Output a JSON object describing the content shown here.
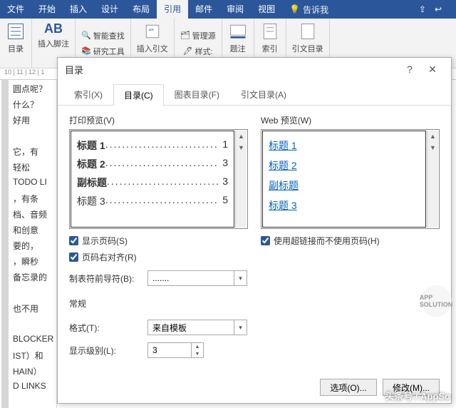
{
  "ribbon": {
    "tabs": [
      "文件",
      "开始",
      "插入",
      "设计",
      "布局",
      "引用",
      "邮件",
      "审阅",
      "视图"
    ],
    "active": "引用",
    "tell_me": "告诉我",
    "groups": {
      "toc": "目录",
      "footnote": {
        "ab": "AB",
        "label": "插入脚注",
        "sup": "1"
      },
      "research": {
        "smart": "智能查找",
        "tool": "研究工具"
      },
      "citation": "插入引文",
      "style": {
        "label": "样式:",
        "manage": "管理源"
      },
      "caption": "题注",
      "index": "索引",
      "cite_toc": "引文目录"
    }
  },
  "ruler": "10 | 11 | 12 | 1",
  "doc_lines": [
    "圆点呢？",
    "什么？",
    "好用",
    "",
    "它，有",
    "轻松",
    "TODO LI",
    "，有条",
    "档、音频",
    "和创意",
    "要的，",
    "，瞬秒",
    "备忘录的",
    "",
    "也不用",
    "",
    "BLOCKER",
    "IST）和",
    "HAIN）",
    "D LINKS"
  ],
  "dialog": {
    "title": "目录",
    "tabs": {
      "index": "索引(X)",
      "toc": "目录(C)",
      "fig": "图表目录(F)",
      "auth": "引文目录(A)"
    },
    "print_preview_label": "打印预览(V)",
    "web_preview_label": "Web 预览(W)",
    "print_items": [
      {
        "title": "标题  1",
        "page": "1",
        "bold": true
      },
      {
        "title": "标题  2",
        "page": "3",
        "bold": true
      },
      {
        "title": "副标题",
        "page": "3",
        "bold": true
      },
      {
        "title": "标题 3",
        "page": "5",
        "bold": false
      }
    ],
    "web_items": [
      "标题  1",
      "标题  2",
      "副标题",
      "标题  3"
    ],
    "show_page_numbers": "显示页码(S)",
    "right_align": "页码右对齐(R)",
    "use_hyperlinks": "使用超链接而不使用页码(H)",
    "tab_leader_label": "制表符前导符(B):",
    "tab_leader_value": ".......",
    "general_label": "常规",
    "format_label": "格式(T):",
    "format_value": "来自模板",
    "levels_label": "显示级别(L):",
    "levels_value": "3",
    "btn_options": "选项(O)...",
    "btn_modify": "修改(M)..."
  },
  "watermark": "头条号 / AppSo",
  "badge": "APP\nSOLUTION"
}
